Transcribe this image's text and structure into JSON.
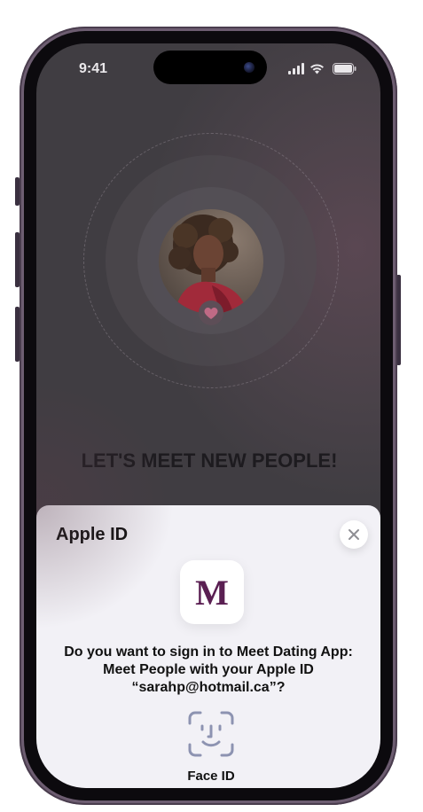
{
  "status_bar": {
    "time": "9:41"
  },
  "onboarding": {
    "headline": "LET'S MEET NEW PEOPLE!"
  },
  "sheet": {
    "title": "Apple ID",
    "app_icon_letter": "M",
    "prompt_line1": "Do you want to sign in to Meet Dating App:",
    "prompt_line2": "Meet People with your Apple ID",
    "prompt_line3": "“sarahp@hotmail.ca”?",
    "faceid_label": "Face ID"
  },
  "icons": {
    "close": "close-icon",
    "faceid": "face-id-icon",
    "heart": "heart-icon",
    "signal": "signal-icon",
    "wifi": "wifi-icon",
    "battery": "battery-icon"
  },
  "colors": {
    "brand": "#5a1f52",
    "heart": "#c06a85",
    "sheet_bg": "#f2f1f6",
    "faceid": "#8d93b1"
  }
}
